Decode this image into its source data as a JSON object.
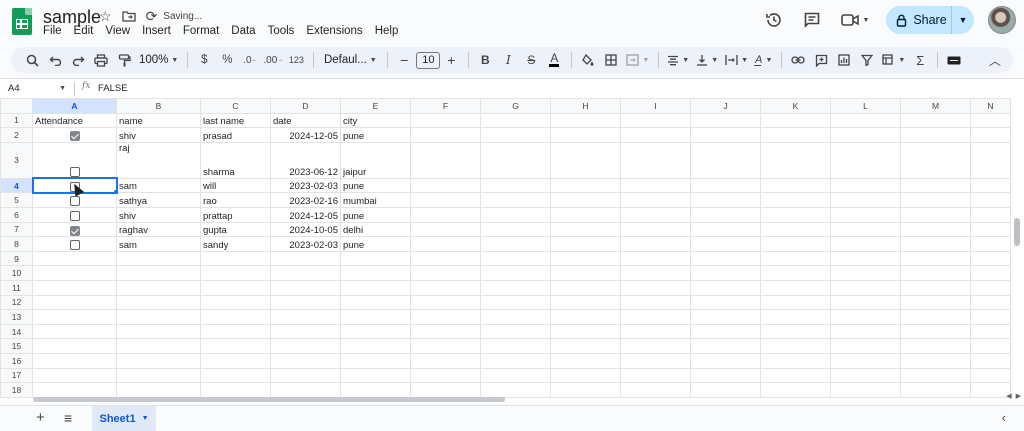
{
  "header": {
    "title": "sample",
    "saving": "Saving...",
    "share_label": "Share"
  },
  "menu": [
    "File",
    "Edit",
    "View",
    "Insert",
    "Format",
    "Data",
    "Tools",
    "Extensions",
    "Help"
  ],
  "toolbar": {
    "zoom": "100%",
    "currency": "$",
    "percent": "%",
    "decimal_decrease": ".0",
    "decimal_increase": ".00",
    "number_format": "123",
    "font": "Defaul...",
    "font_size": "10"
  },
  "formula_bar": {
    "cell_ref": "A4",
    "fx": "fx",
    "value": "FALSE"
  },
  "columns": [
    "A",
    "B",
    "C",
    "D",
    "E",
    "F",
    "G",
    "H",
    "I",
    "J",
    "K",
    "L",
    "M",
    "N"
  ],
  "rows": [
    {
      "n": "1",
      "a": "Attendance",
      "b": "name",
      "c": "last name",
      "d": "date",
      "e": "city"
    },
    {
      "n": "2",
      "checked": true,
      "b": "shiv",
      "c": "prasad",
      "d": "2024-12-05",
      "e": "pune"
    },
    {
      "n": "3",
      "checked": false,
      "b": "raj",
      "c": "sharma",
      "d": "2023-06-12",
      "e": "jaipur"
    },
    {
      "n": "4",
      "checked": false,
      "b": "sam",
      "c": "will",
      "d": "2023-02-03",
      "e": "pune"
    },
    {
      "n": "5",
      "checked": false,
      "b": "sathya",
      "c": "rao",
      "d": "2023-02-16",
      "e": "mumbai"
    },
    {
      "n": "6",
      "checked": false,
      "b": "shiv",
      "c": "prattap",
      "d": "2024-12-05",
      "e": "pune"
    },
    {
      "n": "7",
      "checked": true,
      "b": "raghav",
      "c": "gupta",
      "d": "2024-10-05",
      "e": "delhi"
    },
    {
      "n": "8",
      "checked": false,
      "b": "sam",
      "c": "sandy",
      "d": "2023-02-03",
      "e": "pune"
    },
    {
      "n": "9"
    },
    {
      "n": "10"
    },
    {
      "n": "11"
    },
    {
      "n": "12"
    },
    {
      "n": "13"
    },
    {
      "n": "14"
    },
    {
      "n": "15"
    },
    {
      "n": "16"
    },
    {
      "n": "17"
    },
    {
      "n": "18"
    }
  ],
  "sheets": [
    {
      "name": "Sheet1",
      "active": true
    }
  ],
  "colors": {
    "accent": "#1a73e8",
    "share_bg": "#c2e7ff",
    "logo": "#0f9d58",
    "selected_header": "#d3e3fd"
  }
}
